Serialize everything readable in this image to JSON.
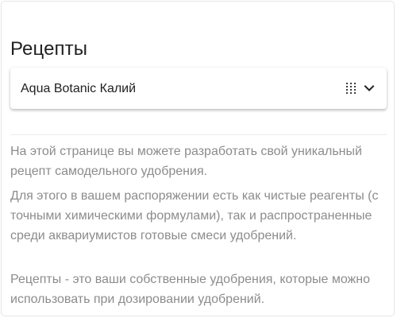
{
  "page": {
    "title": "Рецепты"
  },
  "recipe_select": {
    "value": "Aqua Botanic Калий",
    "icons": [
      "grid-dots-icon",
      "chevron-down-icon"
    ]
  },
  "description": {
    "paragraph_1": "На этой странице вы можете разработать свой уникальный рецепт самодельного удобрения.",
    "paragraph_2": "Для этого в вашем распоряжении есть как чистые реагенты (с точными химическими формулами), так и распространенные среди аквариумистов готовые смеси удобрений.",
    "paragraph_3": "Рецепты - это ваши собственные удобрения, которые можно использовать при дозировании удобрений."
  },
  "colors": {
    "title_text": "#212121",
    "description_text": "#8c8c8c",
    "divider": "#ececec"
  }
}
